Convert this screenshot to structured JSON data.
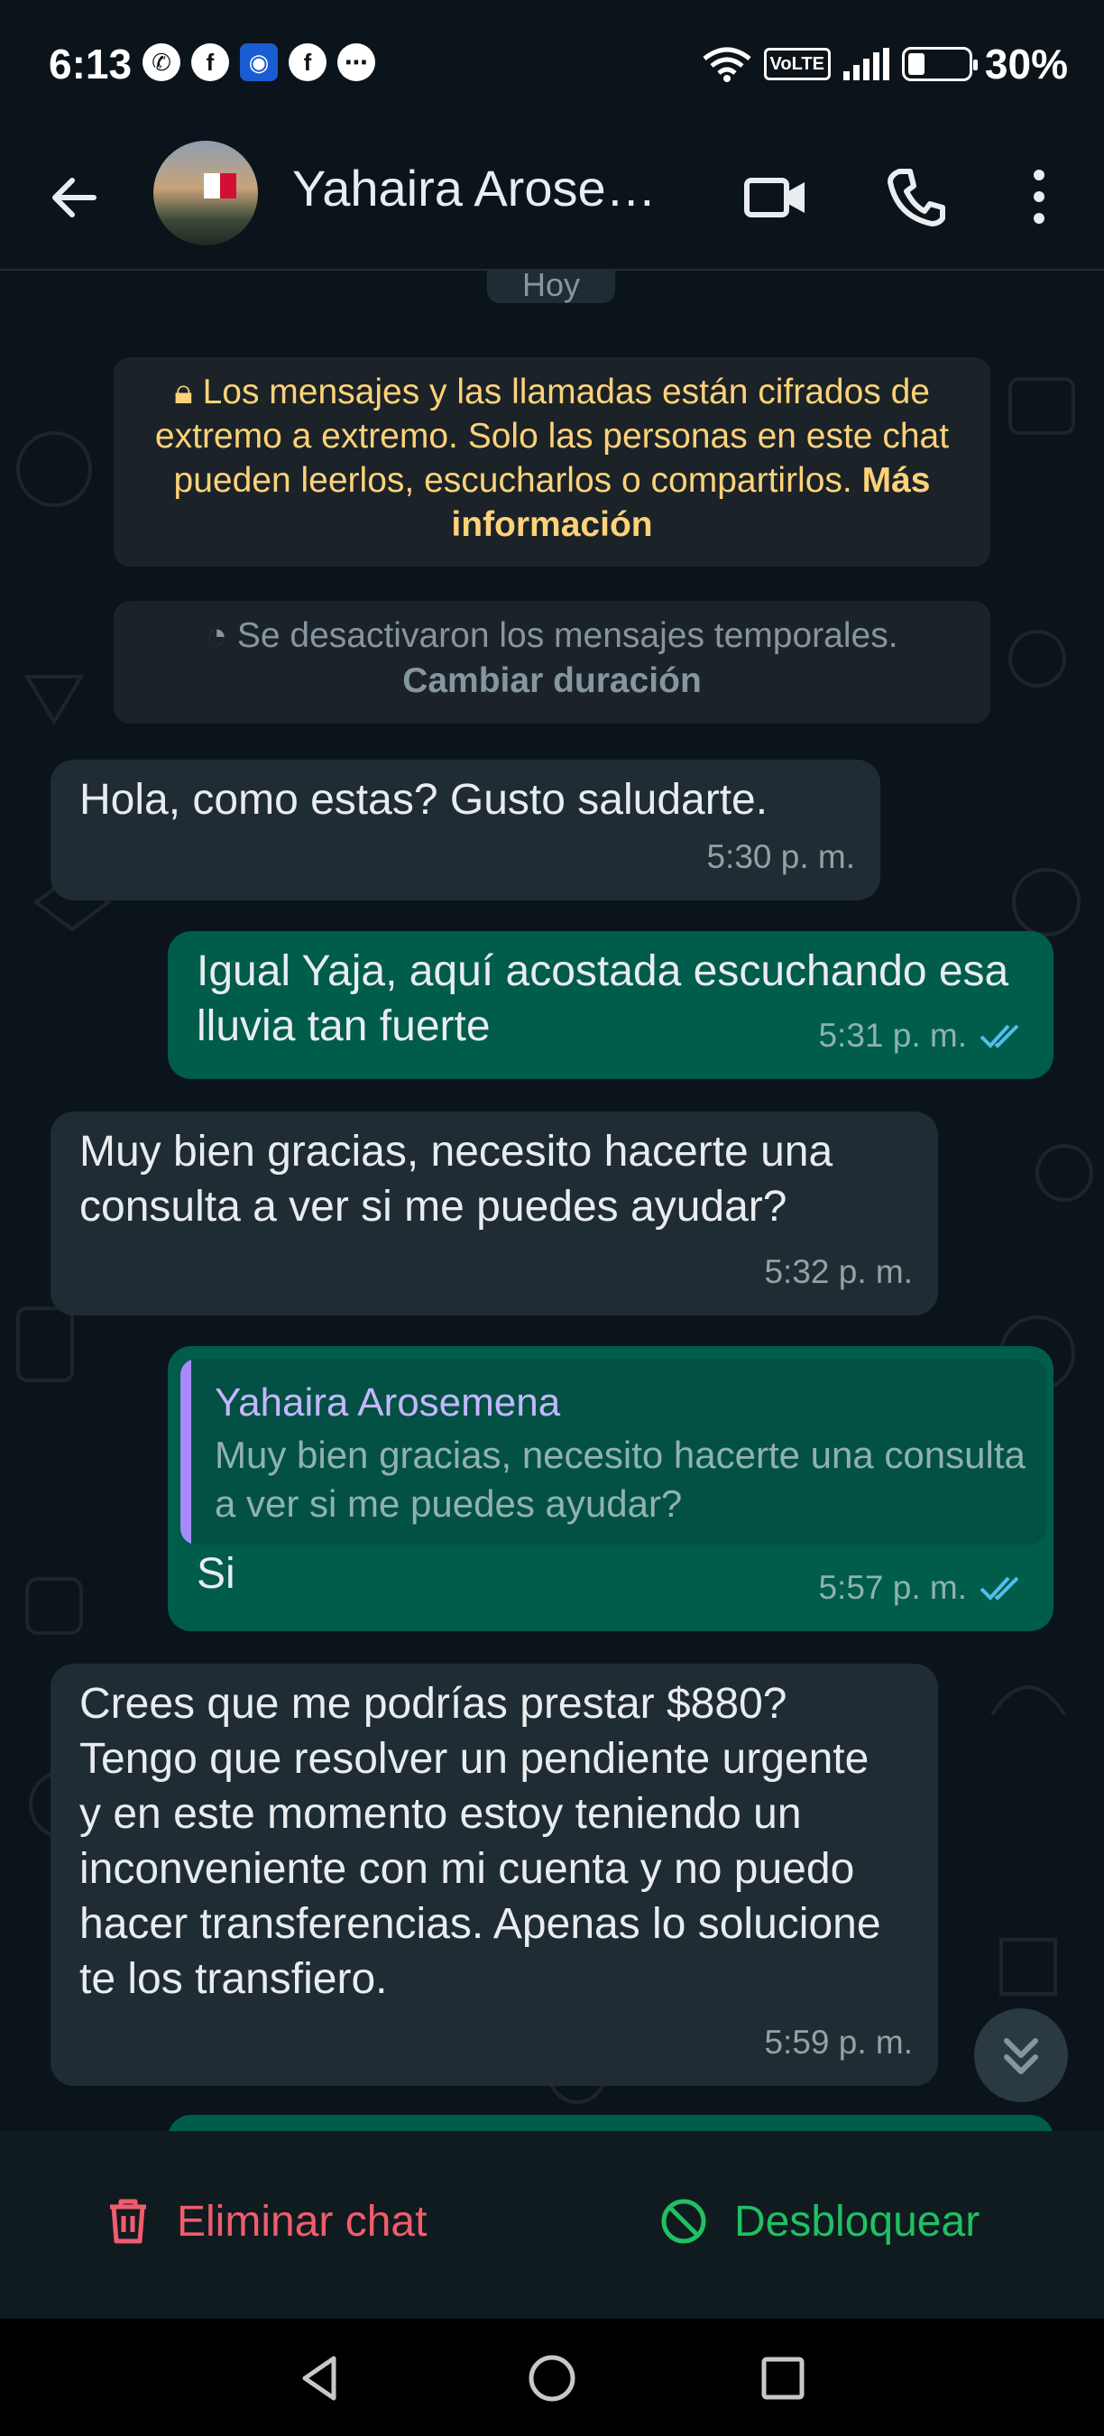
{
  "status_bar": {
    "time": "6:13",
    "notification_icons": [
      "whatsapp-icon",
      "facebook-icon",
      "eye-app-icon",
      "facebook-icon",
      "messenger-icon"
    ],
    "volte": "VoLTE",
    "battery_percent": "30%"
  },
  "header": {
    "contact_name": "Yahaira Arosemena",
    "icons": [
      "back-arrow-icon",
      "video-call-icon",
      "phone-icon",
      "more-options-icon"
    ]
  },
  "chat": {
    "date_label": "Hoy",
    "encryption_notice": {
      "text": "Los mensajes y las llamadas están cifrados de extremo a extremo. Solo las personas en este chat pueden leerlos, escucharlos o compartirlos.",
      "link": "Más información"
    },
    "temporary_notice": {
      "text": "Se desactivaron los mensajes temporales.",
      "link": "Cambiar duración"
    },
    "messages": [
      {
        "direction": "incoming",
        "text": "Hola, como estas? Gusto saludarte.",
        "time": "5:30 p. m."
      },
      {
        "direction": "outgoing",
        "text": "Igual Yaja, aquí acostada escuchando esa lluvia tan fuerte",
        "time": "5:31 p. m.",
        "read": true
      },
      {
        "direction": "incoming",
        "text": "Muy bien gracias, necesito hacerte una consulta a ver si me puedes ayudar?",
        "time": "5:32 p. m."
      },
      {
        "direction": "outgoing",
        "text": "Si",
        "time": "5:57 p. m.",
        "read": true,
        "reply_to": {
          "name": "Yahaira Arosemena",
          "text": "Muy bien gracias, necesito hacerte una consulta a ver si me puedes ayudar?"
        }
      },
      {
        "direction": "incoming",
        "text": "Crees que me podrías prestar $880? Tengo que resolver un pendiente urgente y en este momento estoy teniendo un inconveniente con mi cuenta y no puedo hacer transferencias. Apenas lo solucione te los transfiero.",
        "time": "5:59 p. m."
      }
    ]
  },
  "actions": {
    "delete_chat": "Eliminar chat",
    "unblock": "Desbloquear"
  },
  "colors": {
    "incoming_bubble": "#202c33",
    "outgoing_bubble": "#005c4b",
    "delete": "#f15c6d",
    "unblock": "#21c063",
    "read_ticks": "#53bdeb"
  }
}
